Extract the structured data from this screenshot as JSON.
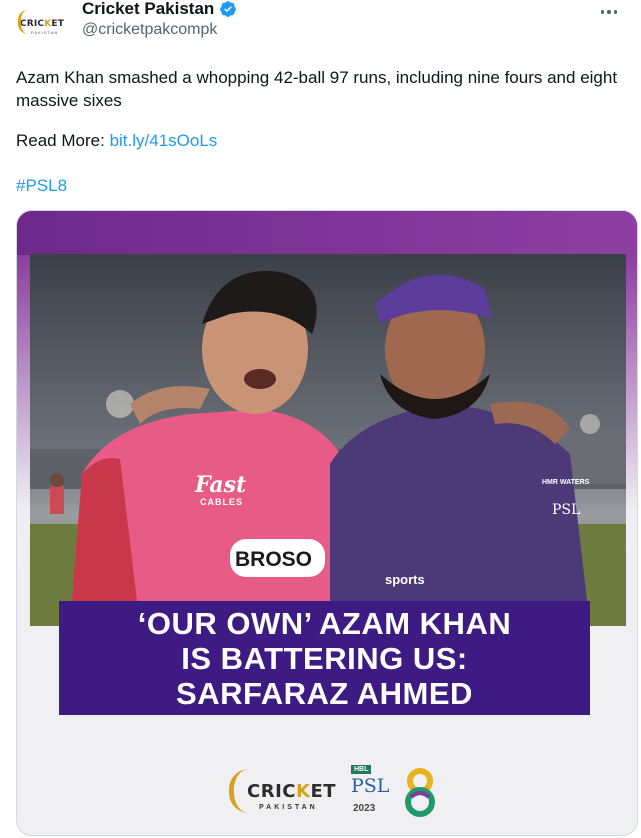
{
  "account": {
    "name": "Cricket Pakistan",
    "handle": "@cricketpakcompk",
    "avatar_logo": {
      "prefix": "CRIC",
      "accent": "K",
      "suffix": "ET",
      "sub": "PAKISTAN"
    },
    "verified_icon": "verified-badge-icon",
    "more_icon": "more-options-icon"
  },
  "tweet": {
    "text": "Azam Khan smashed a whopping 42-ball 97 runs, including nine fours and eight massive sixes",
    "read_more_label": "Read More:",
    "link": "bit.ly/41sOoLs",
    "hashtag": "#PSL8"
  },
  "media": {
    "headline_lines": [
      "‘OUR OWN’ AZAM KHAN",
      "IS BATTERING US:",
      "SARFARAZ AHMED"
    ],
    "photo_text": {
      "shirt_brand": "Fast",
      "shirt_brand_sub": "CABLES",
      "sponsor": "BROSO",
      "jersey_sponsor": "HMR WATERS",
      "jersey_psl": "PSL",
      "jersey_sports": "sports"
    },
    "footer": {
      "logo_prefix": "CRIC",
      "logo_accent": "K",
      "logo_suffix": "ET",
      "logo_sub": "PAKISTAN",
      "psl_hbl": "HBL",
      "psl_text": "PSL",
      "psl_year": "2023"
    }
  },
  "colors": {
    "link": "#1d9bf0",
    "banner": "#3d1b83",
    "purple_band": "#7a2c8f",
    "verified": "#1d9bf0",
    "gold": "#d8a21b"
  }
}
